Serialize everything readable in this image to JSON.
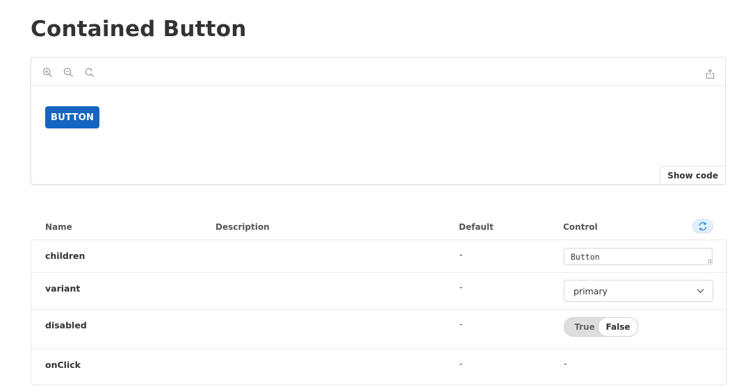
{
  "page": {
    "title": "Contained Button"
  },
  "canvas": {
    "tools": [
      {
        "icon": "zoom-in-icon"
      },
      {
        "icon": "zoom-out-icon"
      },
      {
        "icon": "reset-zoom-icon"
      }
    ],
    "share_icon": "share-icon",
    "preview_button_label": "BUTTON",
    "preview_button_color": "#1565c0",
    "show_code_label": "Show code"
  },
  "argtable": {
    "headers": {
      "name": "Name",
      "description": "Description",
      "default": "Default",
      "control": "Control"
    },
    "reset_icon": "reset-controls-icon",
    "rows": [
      {
        "name": "children",
        "default": "-",
        "control": {
          "type": "text",
          "value": "Button"
        }
      },
      {
        "name": "variant",
        "default": "-",
        "control": {
          "type": "select",
          "value": "primary"
        }
      },
      {
        "name": "disabled",
        "default": "-",
        "control": {
          "type": "toggle",
          "true_label": "True",
          "false_label": "False",
          "value": false
        }
      },
      {
        "name": "onClick",
        "default": "-",
        "control": {
          "type": "none",
          "value": "-"
        }
      }
    ]
  }
}
